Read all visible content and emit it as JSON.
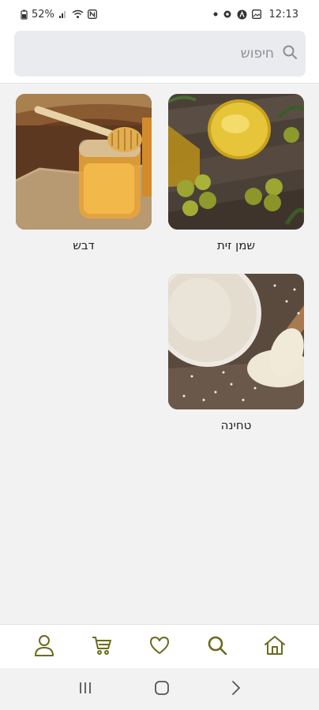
{
  "status_bar": {
    "battery": "52%",
    "time": "12:13"
  },
  "search": {
    "placeholder": "חיפוש"
  },
  "categories": [
    {
      "label": "שמן זית",
      "image": "olive-oil"
    },
    {
      "label": "דבש",
      "image": "honey"
    },
    {
      "label": "טחינה",
      "image": "tahini"
    }
  ],
  "bottom_nav": {
    "accent": "#6b6b1e",
    "items": [
      "home-icon",
      "search-icon",
      "heart-icon",
      "cart-icon",
      "user-icon"
    ]
  },
  "system_nav": [
    "recent-apps-icon",
    "home-circle-icon",
    "back-icon"
  ]
}
